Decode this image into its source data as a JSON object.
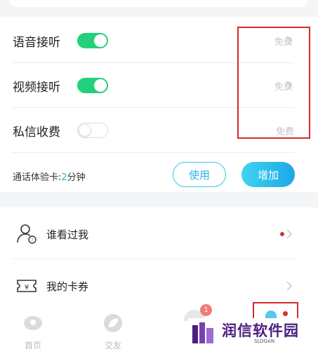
{
  "settings": {
    "rows": [
      {
        "label": "语音接听",
        "toggle": "on",
        "price": "免费"
      },
      {
        "label": "视频接听",
        "toggle": "on",
        "price": "免费"
      },
      {
        "label": "私信收费",
        "toggle": "off",
        "price": "免费"
      }
    ]
  },
  "experience": {
    "prefix": "通话体验卡:",
    "count": "2",
    "unit": "分钟",
    "use_label": "使用",
    "add_label": "增加"
  },
  "list": {
    "items": [
      {
        "label": "谁看过我",
        "icon": "user-visitor-icon",
        "has_dot": true
      },
      {
        "label": "我的卡券",
        "icon": "coupon-icon",
        "has_dot": false
      }
    ]
  },
  "tabbar": {
    "tabs": [
      {
        "label": "首页",
        "icon": "home-icon"
      },
      {
        "label": "交友",
        "icon": "leaf-icon"
      }
    ],
    "badge": "1"
  },
  "watermark": {
    "title": "润信软件园",
    "slogan": "SLOGAN"
  },
  "colors": {
    "toggle_on": "#22d17a",
    "accent": "#2bb4e6",
    "highlight": "#d42a2a",
    "watermark": "#4a1f7e"
  }
}
